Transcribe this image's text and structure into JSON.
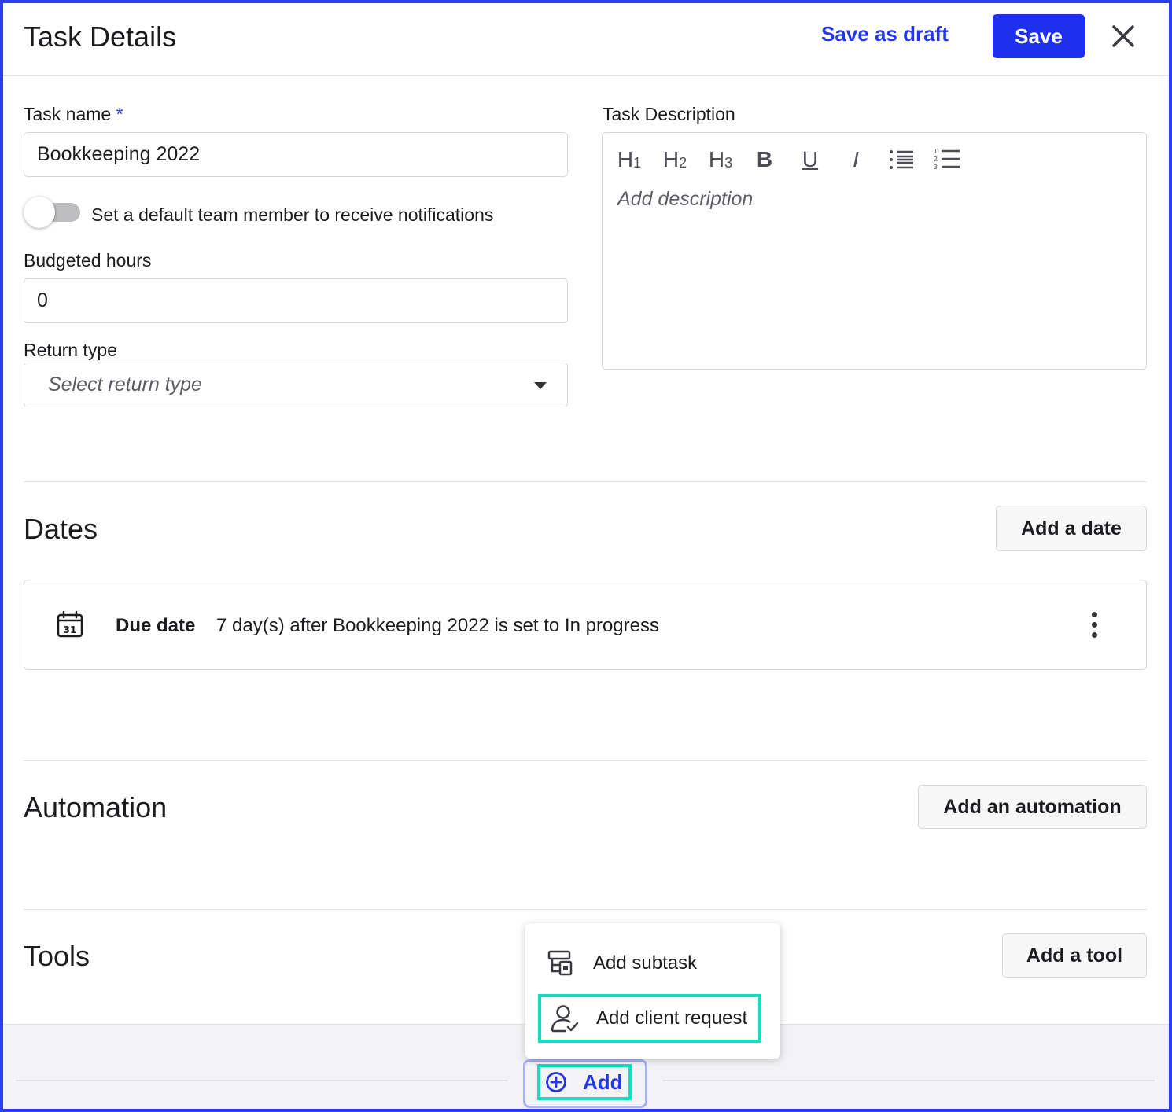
{
  "header": {
    "title": "Task Details",
    "save_draft_label": "Save as draft",
    "save_label": "Save",
    "accent_color": "#1f2fee"
  },
  "form": {
    "task_name": {
      "label": "Task name",
      "required_mark": "*",
      "value": "Bookkeeping 2022"
    },
    "notify_toggle": {
      "label": "Set a default team member to receive notifications",
      "on": false
    },
    "budgeted_hours": {
      "label": "Budgeted hours",
      "value": "0"
    },
    "return_type": {
      "label": "Return type",
      "placeholder": "Select return type"
    },
    "description": {
      "label": "Task Description",
      "placeholder": "Add description",
      "toolbar": [
        "heading-1",
        "heading-2",
        "heading-3",
        "bold",
        "underline",
        "italic",
        "bullet-list",
        "numbered-list"
      ]
    }
  },
  "dates": {
    "title": "Dates",
    "add_label": "Add a date",
    "items": [
      {
        "icon": "calendar-icon",
        "icon_day": "31",
        "label": "Due date",
        "text": "7 day(s) after Bookkeeping 2022 is set to In progress"
      }
    ]
  },
  "automation": {
    "title": "Automation",
    "add_label": "Add an automation"
  },
  "tools": {
    "title": "Tools",
    "add_label": "Add a tool"
  },
  "add_menu": {
    "items": [
      {
        "icon": "subtask-icon",
        "label": "Add subtask"
      },
      {
        "icon": "client-request-icon",
        "label": "Add client request",
        "highlighted": true
      }
    ],
    "highlight_color": "#11dfc0"
  },
  "footer": {
    "add_label": "Add",
    "add_icon": "plus-circle-icon"
  }
}
